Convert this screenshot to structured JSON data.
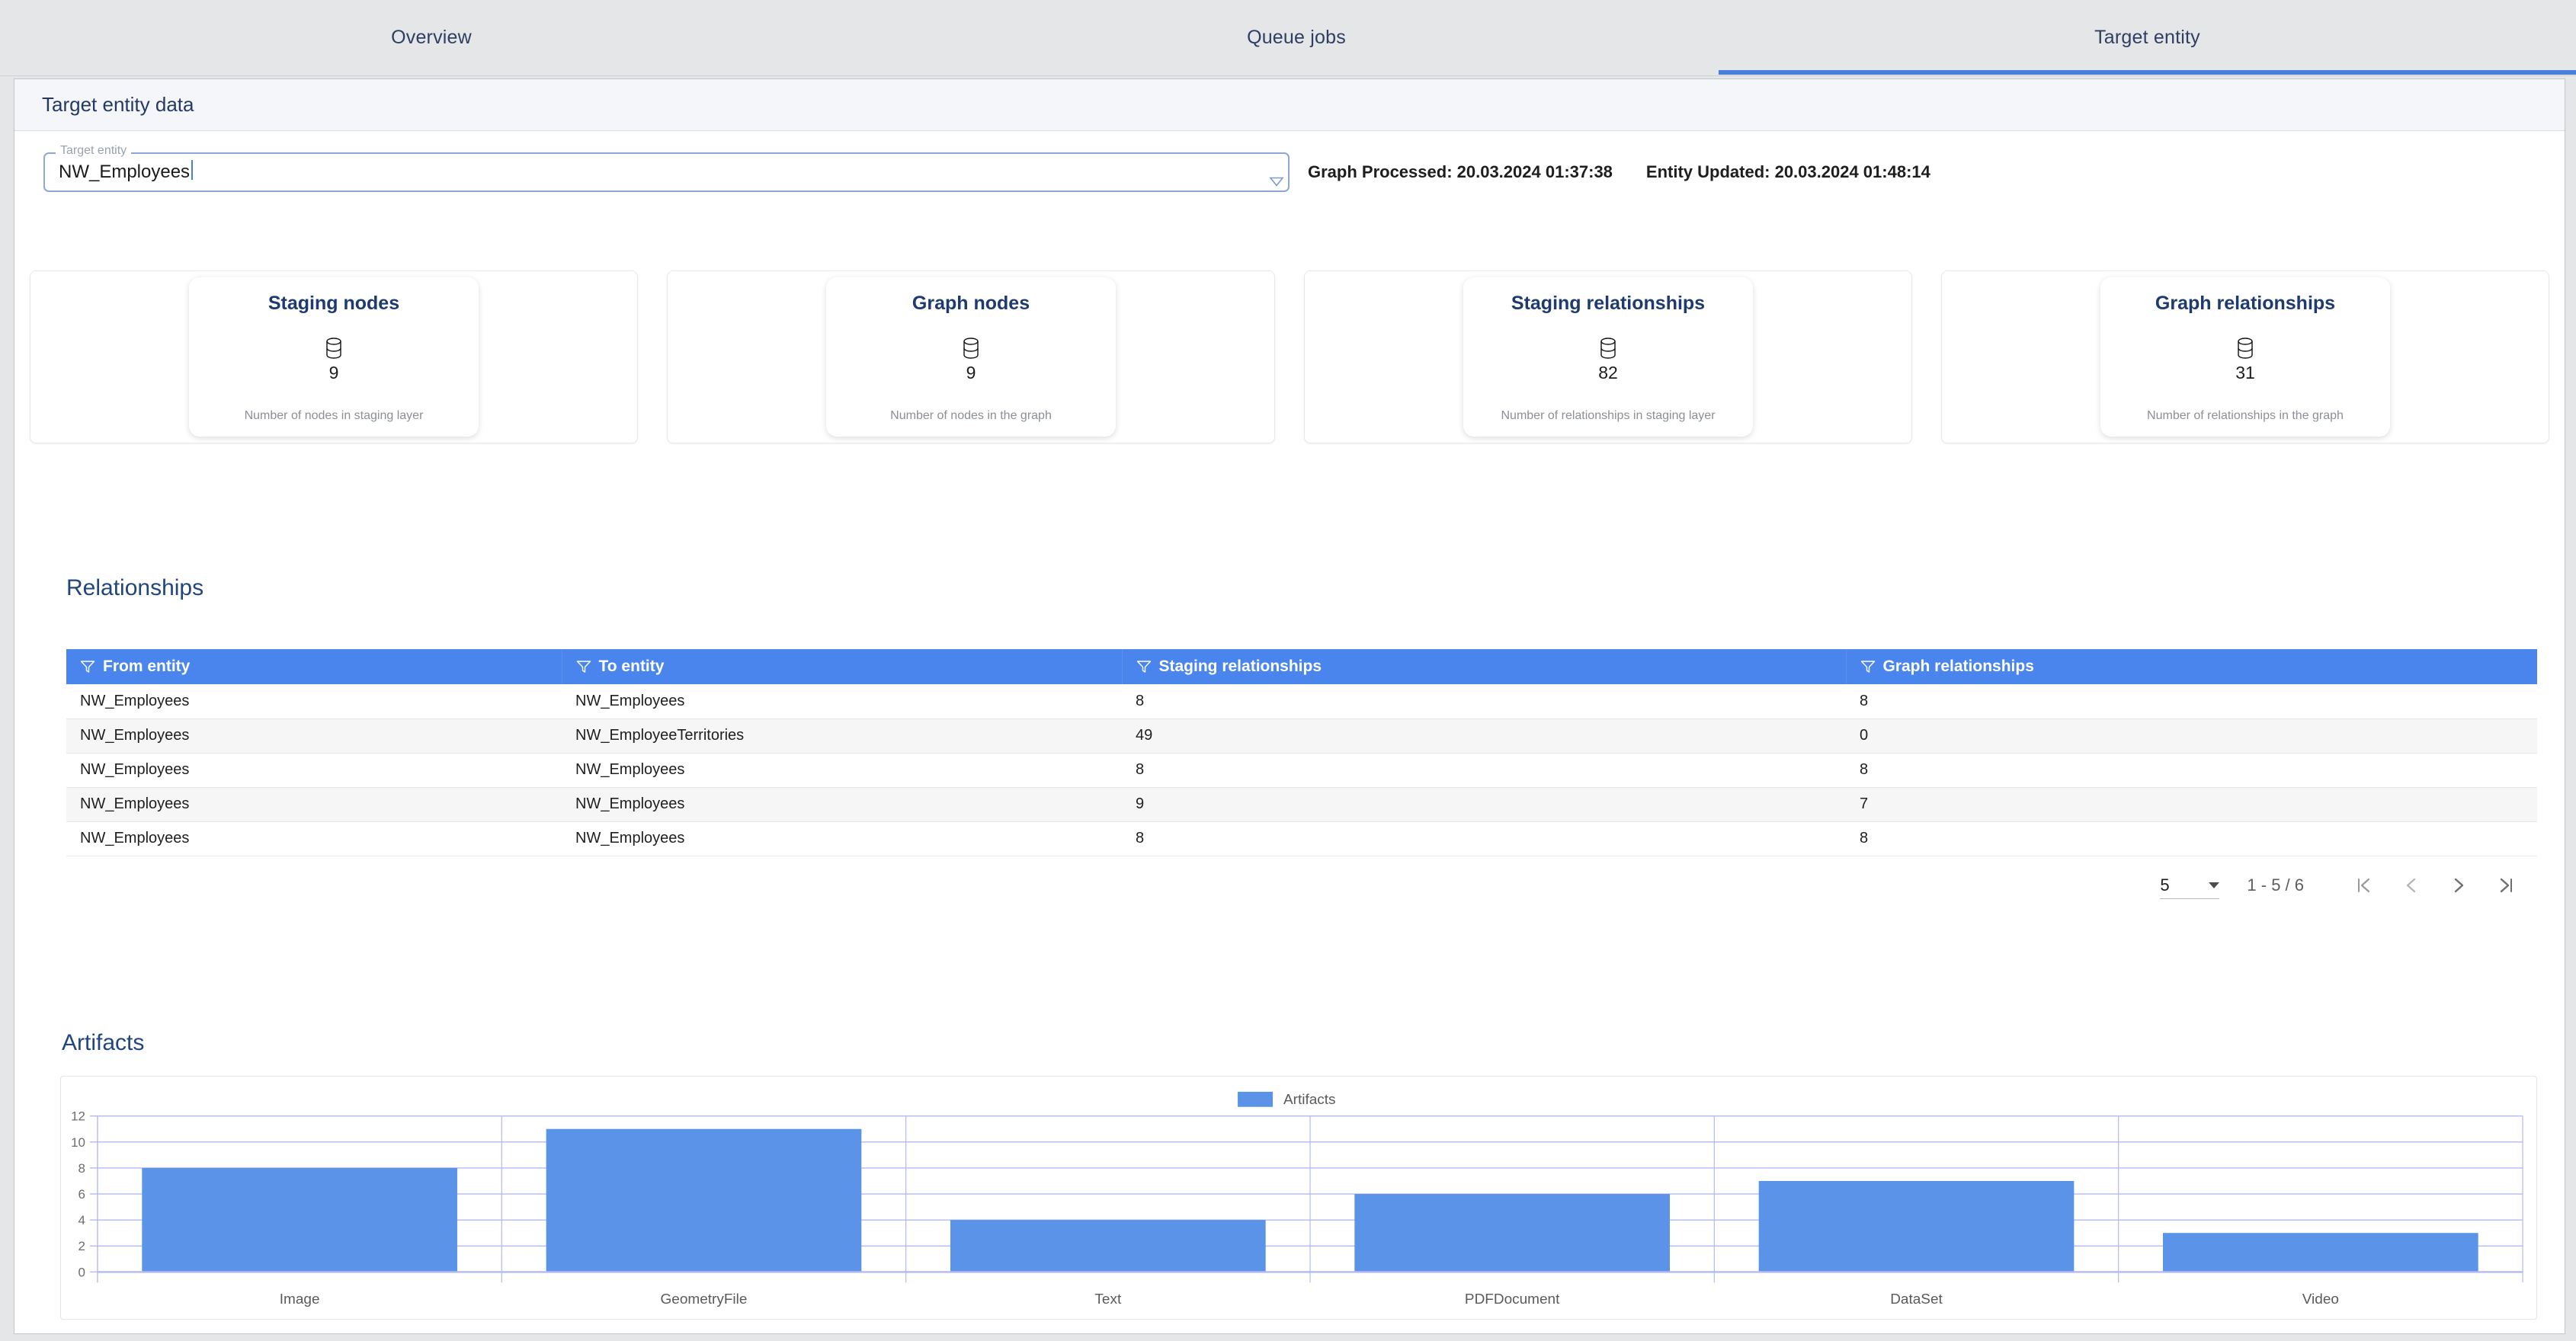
{
  "tabs": [
    {
      "label": "Overview",
      "active": false
    },
    {
      "label": "Queue jobs",
      "active": false
    },
    {
      "label": "Target entity",
      "active": true
    }
  ],
  "panel": {
    "header_title": "Target entity data"
  },
  "target_entity_field": {
    "legend": "Target entity",
    "value": "NW_Employees",
    "dropdown_icon": "chevron-down-icon"
  },
  "meta": {
    "graph_processed": "Graph Processed: 20.03.2024 01:37:38",
    "entity_updated": "Entity Updated: 20.03.2024 01:48:14"
  },
  "stat_cards": [
    {
      "title": "Staging nodes",
      "icon": "database-icon",
      "value": "9",
      "description": "Number of nodes in staging layer"
    },
    {
      "title": "Graph nodes",
      "icon": "database-icon",
      "value": "9",
      "description": "Number of nodes in the graph"
    },
    {
      "title": "Staging relationships",
      "icon": "database-icon",
      "value": "82",
      "description": "Number of relationships in staging layer"
    },
    {
      "title": "Graph relationships",
      "icon": "database-icon",
      "value": "31",
      "description": "Number of relationships in the graph"
    }
  ],
  "relationships": {
    "section_title": "Relationships",
    "columns": [
      {
        "label": "From entity",
        "filter_icon": "filter-icon"
      },
      {
        "label": "To entity",
        "filter_icon": "filter-icon"
      },
      {
        "label": "Staging relationships",
        "filter_icon": "filter-icon"
      },
      {
        "label": "Graph relationships",
        "filter_icon": "filter-icon"
      }
    ],
    "rows": [
      {
        "from": "NW_Employees",
        "to": "NW_Employees",
        "staging": "8",
        "graph": "8"
      },
      {
        "from": "NW_Employees",
        "to": "NW_EmployeeTerritories",
        "staging": "49",
        "graph": "0"
      },
      {
        "from": "NW_Employees",
        "to": "NW_Employees",
        "staging": "8",
        "graph": "8"
      },
      {
        "from": "NW_Employees",
        "to": "NW_Employees",
        "staging": "9",
        "graph": "7"
      },
      {
        "from": "NW_Employees",
        "to": "NW_Employees",
        "staging": "8",
        "graph": "8"
      }
    ]
  },
  "paginator": {
    "page_size": "5",
    "range_label": "1 - 5 / 6",
    "first_label": "first-page-icon",
    "prev_label": "previous-page-icon",
    "next_label": "next-page-icon",
    "last_label": "last-page-icon"
  },
  "artifacts": {
    "section_title": "Artifacts"
  },
  "chart_data": {
    "type": "bar",
    "title": "",
    "categories": [
      "Image",
      "GeometryFile",
      "Text",
      "PDFDocument",
      "DataSet",
      "Video"
    ],
    "values": [
      8,
      11,
      4,
      6,
      7,
      3
    ],
    "series": [
      {
        "name": "Artifacts",
        "values": [
          8,
          11,
          4,
          6,
          7,
          3
        ],
        "color": "#5b93e8"
      }
    ],
    "legend": [
      "Artifacts"
    ],
    "legend_position": "top-center",
    "xlabel": "",
    "ylabel": "",
    "ylim": [
      0,
      12
    ],
    "yticks": [
      0,
      2,
      4,
      6,
      8,
      10,
      12
    ],
    "grid": true,
    "grid_color": "#b3b9f2"
  },
  "colors": {
    "accent_blue": "#4a85ee",
    "tab_underline": "#4a7fdb",
    "bar_blue": "#5b93e8",
    "title_navy": "#21457f",
    "page_bg": "#e4e6e8"
  }
}
